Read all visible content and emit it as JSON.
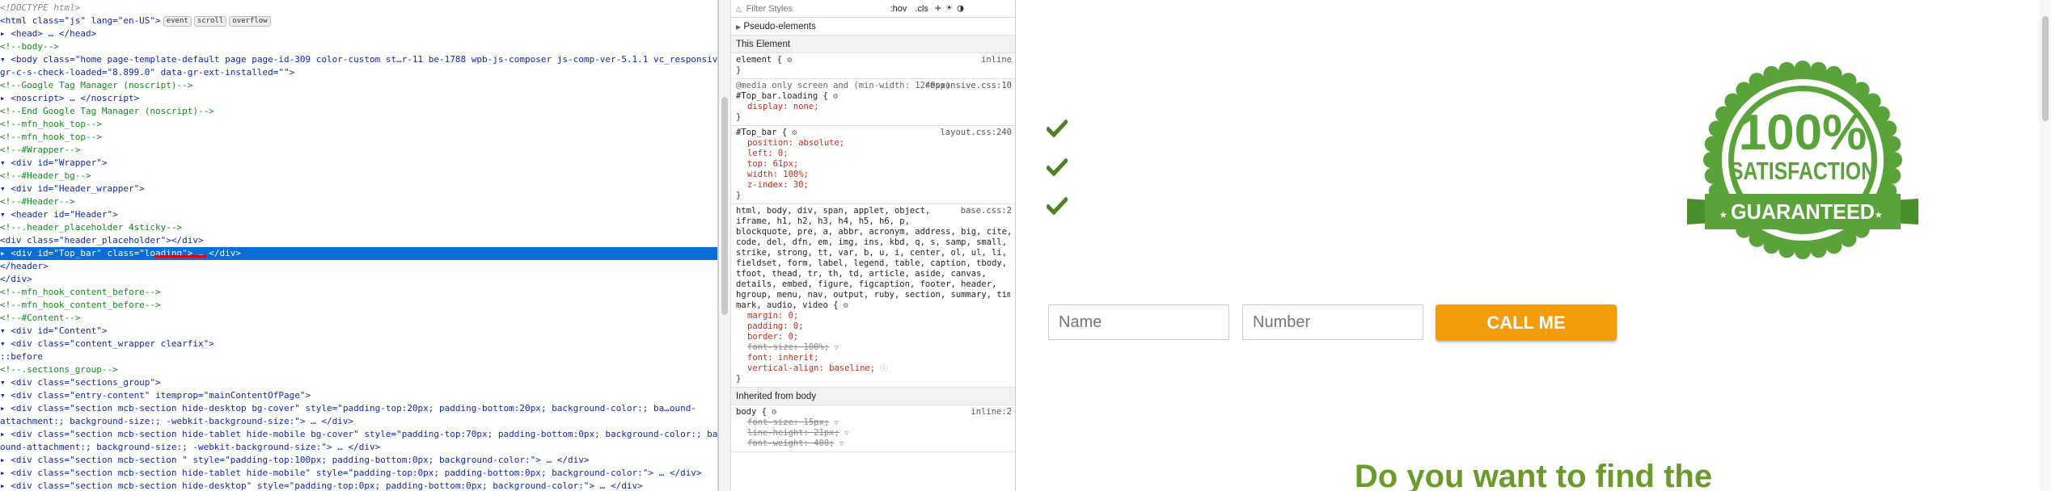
{
  "inspector": {
    "lines": [
      {
        "text": "<!DOCTYPE html>",
        "kind": "doc"
      },
      {
        "text": "<html class=\"js\" lang=\"en-US\">",
        "kind": "tag",
        "badges": [
          "event",
          "scroll",
          "overflow"
        ]
      },
      {
        "text": "▸ <head> … </head>",
        "kind": "tag"
      },
      {
        "text": "  <!--body-->",
        "kind": "cmt"
      },
      {
        "text": "▾ <body class=\"home page-template-default page page-id-309 color-custom st…r-11 be-1788 wpb-js-composer js-comp-ver-5.1.1 vc_responsive\" data-new-",
        "kind": "tag"
      },
      {
        "text": "  gr-c-s-check-loaded=\"8.899.0\" data-gr-ext-installed=\"\">",
        "kind": "tag"
      },
      {
        "text": "    <!--Google Tag Manager (noscript)-->",
        "kind": "cmt"
      },
      {
        "text": "  ▸ <noscript> … </noscript>",
        "kind": "tag"
      },
      {
        "text": "    <!--End Google Tag Manager (noscript)-->",
        "kind": "cmt"
      },
      {
        "text": "    <!--mfn_hook_top-->",
        "kind": "cmt"
      },
      {
        "text": "    <!--mfn_hook_top-->",
        "kind": "cmt"
      },
      {
        "text": "    <!--#Wrapper-->",
        "kind": "cmt"
      },
      {
        "text": "  ▾ <div id=\"Wrapper\">",
        "kind": "tag"
      },
      {
        "text": "      <!--#Header_bg-->",
        "kind": "cmt"
      },
      {
        "text": "    ▾ <div id=\"Header_wrapper\">",
        "kind": "tag"
      },
      {
        "text": "        <!--#Header-->",
        "kind": "cmt"
      },
      {
        "text": "      ▾ <header id=\"Header\">",
        "kind": "tag"
      },
      {
        "text": "          <!--.header_placeholder 4sticky-->",
        "kind": "cmt"
      },
      {
        "text": "          <div class=\"header_placeholder\"></div>",
        "kind": "tag"
      },
      {
        "text": "        ▸ <div id=\"Top_bar\" class=\"loading\"> … </div>",
        "kind": "sel"
      },
      {
        "text": "        </header>",
        "kind": "tag"
      },
      {
        "text": "      </div>",
        "kind": "tag"
      },
      {
        "text": "      <!--mfn_hook_content_before-->",
        "kind": "cmt"
      },
      {
        "text": "      <!--mfn_hook_content_before-->",
        "kind": "cmt"
      },
      {
        "text": "      <!--#Content-->",
        "kind": "cmt"
      },
      {
        "text": "    ▾ <div id=\"Content\">",
        "kind": "tag"
      },
      {
        "text": "      ▾ <div class=\"content_wrapper clearfix\">",
        "kind": "tag"
      },
      {
        "text": "          ::before",
        "kind": "tag"
      },
      {
        "text": "          <!--.sections_group-->",
        "kind": "cmt"
      },
      {
        "text": "        ▾ <div class=\"sections_group\">",
        "kind": "tag"
      },
      {
        "text": "          ▾ <div class=\"entry-content\" itemprop=\"mainContentOfPage\">",
        "kind": "tag"
      },
      {
        "text": "            ▸ <div class=\"section mcb-section hide-desktop bg-cover\" style=\"padding-top:20px; padding-bottom:20px; background-color:; ba…ound-",
        "kind": "tag"
      },
      {
        "text": "              attachment:; background-size:; -webkit-background-size:\"> … </div>",
        "kind": "tag"
      },
      {
        "text": "            ▸ <div class=\"section mcb-section hide-tablet hide-mobile bg-cover\" style=\"padding-top:70px; padding-bottom:0px; background-color:; bac…",
        "kind": "tag"
      },
      {
        "text": "              ound-attachment:; background-size:; -webkit-background-size:\"> … </div>",
        "kind": "tag"
      },
      {
        "text": "            ▸ <div class=\"section mcb-section \" style=\"padding-top:100px; padding-bottom:0px; background-color:\"> … </div>",
        "kind": "tag"
      },
      {
        "text": "            ▸ <div class=\"section mcb-section hide-tablet hide-mobile\" style=\"padding-top:0px; padding-bottom:0px; background-color:\"> … </div>",
        "kind": "tag"
      },
      {
        "text": "            ▸ <div class=\"section mcb-section hide-desktop\" style=\"padding-top:0px; padding-bottom:0px; background-color:\"> … </div>",
        "kind": "tag"
      }
    ]
  },
  "styles": {
    "filter_placeholder": "Filter Styles",
    "hov_label": ":hov",
    "cls_label": ".cls",
    "add_label": "+",
    "pseudo_header": "Pseudo-elements",
    "this_element_header": "This Element",
    "inherited_header": "Inherited from body",
    "rules": [
      {
        "source": "inline",
        "lines": [
          "element {",
          "}"
        ]
      },
      {
        "source": "responsive.css:10",
        "lines": [
          "@media only screen and (min-width: 1240px)",
          "#Top_bar.loading {",
          "  display: none;",
          "}"
        ]
      },
      {
        "source": "layout.css:240",
        "lines": [
          "#Top_bar {",
          "  position: absolute;",
          "  left: 0;",
          "  top: 61px;",
          "  width: 100%;",
          "  z-index: 30;",
          "}"
        ]
      },
      {
        "source": "base.css:2",
        "lines": [
          "html, body, div, span, applet, object,",
          "iframe, h1, h2, h3, h4, h5, h6, p,",
          "blockquote, pre, a, abbr, acronym, address, big, cite,",
          "code, del, dfn, em, img, ins, kbd, q, s, samp, small,",
          "strike, strong, tt, var, b, u, i, center, ol, ul, li,",
          "fieldset, form, label, legend, table, caption, tbody,",
          "tfoot, thead, tr, th, td, article, aside, canvas,",
          "details, embed, figure, figcaption, footer, header,",
          "hgroup, menu, nav, output, ruby, section, summary, time,",
          "mark, audio, video {",
          "  margin: 0;",
          "  padding: 0;",
          "  border: 0;",
          "  font-size: 100%;",
          "  font: inherit;",
          "  vertical-align: baseline;",
          "}"
        ]
      },
      {
        "source": "inline:2",
        "lines": [
          "body {",
          "  font-size: 15px;",
          "  line-height: 21px;",
          "  font-weight: 400;"
        ]
      }
    ]
  },
  "page": {
    "name_placeholder": "Name",
    "number_placeholder": "Number",
    "call_button_label": "CALL ME",
    "headline": "Do you want to find the",
    "seal": {
      "line1": "100%",
      "line2": "SATISFACTION",
      "line3": "GUARANTEED"
    },
    "accent_color": "#f59c0a",
    "brand_green": "#6a9a2a"
  }
}
